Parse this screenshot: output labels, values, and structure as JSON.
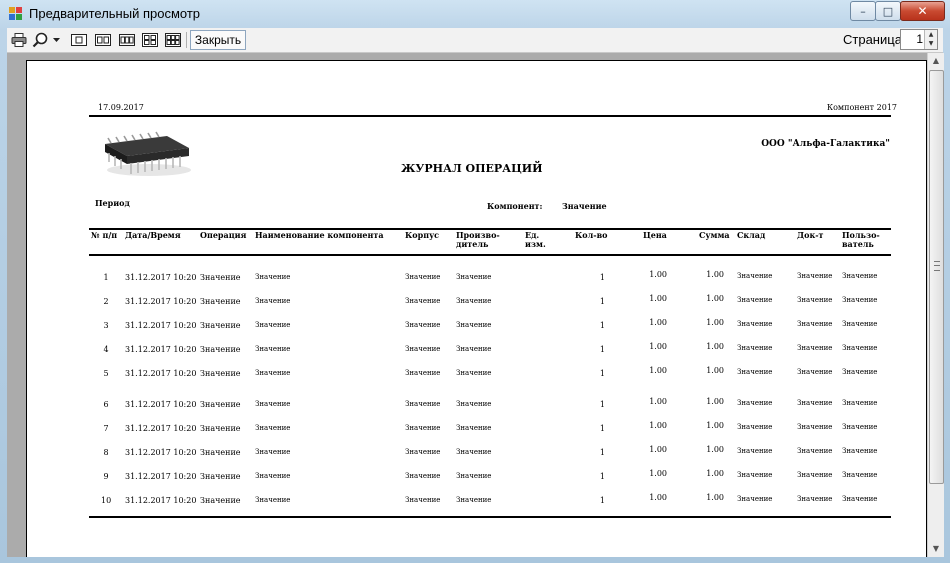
{
  "window": {
    "title": "Предварительный просмотр",
    "buttons": {
      "minimize": "–",
      "maximize": "□",
      "close": "✕"
    }
  },
  "toolbar": {
    "icons": [
      "printer-icon",
      "zoom-icon",
      "dropdown-arrow-icon",
      "one-page-icon",
      "two-pages-icon",
      "three-pages-icon",
      "four-pages-icon",
      "six-pages-icon"
    ],
    "close_label": "Закрыть",
    "page_label": "Страница",
    "page_value": "1"
  },
  "report": {
    "date": "17.09.2017",
    "component_header": "Компонент 2017",
    "organization": "ООО \"Альфа-Галактика\"",
    "title": "ЖУРНАЛ ОПЕРАЦИЙ",
    "period_label": "Период",
    "component_label": "Компонент:",
    "component_value": "Значение",
    "columns": [
      {
        "l1": "№ п/п",
        "l2": ""
      },
      {
        "l1": "Дата/Время",
        "l2": ""
      },
      {
        "l1": "Операция",
        "l2": ""
      },
      {
        "l1": "Наименование компонента",
        "l2": ""
      },
      {
        "l1": "Корпус",
        "l2": ""
      },
      {
        "l1": "Произво-",
        "l2": "дитель"
      },
      {
        "l1": "Ед.",
        "l2": "изм."
      },
      {
        "l1": "Кол-во",
        "l2": ""
      },
      {
        "l1": "Цена",
        "l2": ""
      },
      {
        "l1": "Сумма",
        "l2": ""
      },
      {
        "l1": "Склад",
        "l2": ""
      },
      {
        "l1": "Док-т",
        "l2": ""
      },
      {
        "l1": "Пользо-",
        "l2": "ватель"
      }
    ],
    "rows": [
      {
        "num": "1",
        "dt": "31.12.2017 10:20",
        "op": "Значение",
        "name": "Значение",
        "body": "Значение",
        "maker": "Значение",
        "qty": "1",
        "price": "1.00",
        "sum": "1.00",
        "store": "Значение",
        "doc": "Значение",
        "user": "Значение"
      },
      {
        "num": "2",
        "dt": "31.12.2017 10:20",
        "op": "Значение",
        "name": "Значение",
        "body": "Значение",
        "maker": "Значение",
        "qty": "1",
        "price": "1.00",
        "sum": "1.00",
        "store": "Значение",
        "doc": "Значение",
        "user": "Значение"
      },
      {
        "num": "3",
        "dt": "31.12.2017 10:20",
        "op": "Значение",
        "name": "Значение",
        "body": "Значение",
        "maker": "Значение",
        "qty": "1",
        "price": "1.00",
        "sum": "1.00",
        "store": "Значение",
        "doc": "Значение",
        "user": "Значение"
      },
      {
        "num": "4",
        "dt": "31.12.2017 10:20",
        "op": "Значение",
        "name": "Значение",
        "body": "Значение",
        "maker": "Значение",
        "qty": "1",
        "price": "1.00",
        "sum": "1.00",
        "store": "Значение",
        "doc": "Значение",
        "user": "Значение"
      },
      {
        "num": "5",
        "dt": "31.12.2017 10:20",
        "op": "Значение",
        "name": "Значение",
        "body": "Значение",
        "maker": "Значение",
        "qty": "1",
        "price": "1.00",
        "sum": "1.00",
        "store": "Значение",
        "doc": "Значение",
        "user": "Значение"
      },
      {
        "num": "6",
        "dt": "31.12.2017 10:20",
        "op": "Значение",
        "name": "Значение",
        "body": "Значение",
        "maker": "Значение",
        "qty": "1",
        "price": "1.00",
        "sum": "1.00",
        "store": "Значение",
        "doc": "Значение",
        "user": "Значение"
      },
      {
        "num": "7",
        "dt": "31.12.2017 10:20",
        "op": "Значение",
        "name": "Значение",
        "body": "Значение",
        "maker": "Значение",
        "qty": "1",
        "price": "1.00",
        "sum": "1.00",
        "store": "Значение",
        "doc": "Значение",
        "user": "Значение"
      },
      {
        "num": "8",
        "dt": "31.12.2017 10:20",
        "op": "Значение",
        "name": "Значение",
        "body": "Значение",
        "maker": "Значение",
        "qty": "1",
        "price": "1.00",
        "sum": "1.00",
        "store": "Значение",
        "doc": "Значение",
        "user": "Значение"
      },
      {
        "num": "9",
        "dt": "31.12.2017 10:20",
        "op": "Значение",
        "name": "Значение",
        "body": "Значение",
        "maker": "Значение",
        "qty": "1",
        "price": "1.00",
        "sum": "1.00",
        "store": "Значение",
        "doc": "Значение",
        "user": "Значение"
      },
      {
        "num": "10",
        "dt": "31.12.2017 10:20",
        "op": "Значение",
        "name": "Значение",
        "body": "Значение",
        "maker": "Значение",
        "qty": "1",
        "price": "1.00",
        "sum": "1.00",
        "store": "Значение",
        "doc": "Значение",
        "user": "Значение"
      }
    ]
  },
  "colors": {
    "window_frame": "#bcd4e8",
    "close_button": "#c94a31",
    "preview_bg": "#ababab"
  }
}
